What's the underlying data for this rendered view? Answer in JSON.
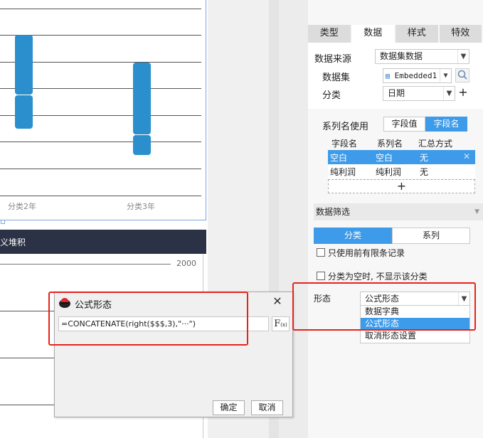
{
  "canvas": {
    "chart1": {
      "category_labels": [
        "分类2年",
        "分类3年"
      ]
    },
    "chart2": {
      "title": "义堆积",
      "tick_label": "2000"
    }
  },
  "panel": {
    "tabs": [
      "类型",
      "数据",
      "样式",
      "特效"
    ],
    "active_tab": "数据",
    "data_source": {
      "label": "数据来源",
      "value": "数据集数据"
    },
    "dataset": {
      "label": "数据集",
      "value": "Embedded1"
    },
    "category": {
      "label": "分类",
      "value": "日期"
    },
    "series_name_use": {
      "label": "系列名使用",
      "options": [
        "字段值",
        "字段名"
      ],
      "selected": "字段名"
    },
    "table": {
      "headers": [
        "字段名",
        "系列名",
        "汇总方式"
      ],
      "rows": [
        {
          "field": "空白",
          "series": "空白",
          "summary": "无"
        },
        {
          "field": "纯利润",
          "series": "纯利润",
          "summary": "无"
        }
      ]
    },
    "filter": {
      "label": "数据筛选",
      "tabs": [
        "分类",
        "系列"
      ],
      "active": "分类",
      "only_first_records": "只使用前有限条记录",
      "hide_empty": "分类为空时, 不显示该分类"
    },
    "form": {
      "label": "形态",
      "value": "公式形态",
      "options": [
        "数据字典",
        "公式形态",
        "取消形态设置"
      ],
      "selected": "公式形态"
    }
  },
  "dialog": {
    "title": "公式形态",
    "formula": "=CONCATENATE(right($$$,3),\"···\")",
    "fx_label": "F",
    "fx_sub": "(x)",
    "ok": "确定",
    "cancel": "取消",
    "close_glyph": "✕"
  },
  "colors": {
    "accent": "#3d9bea",
    "bar": "#2b8fcd",
    "highlight": "#e8221b",
    "chart_title_bg": "#2c3246"
  }
}
